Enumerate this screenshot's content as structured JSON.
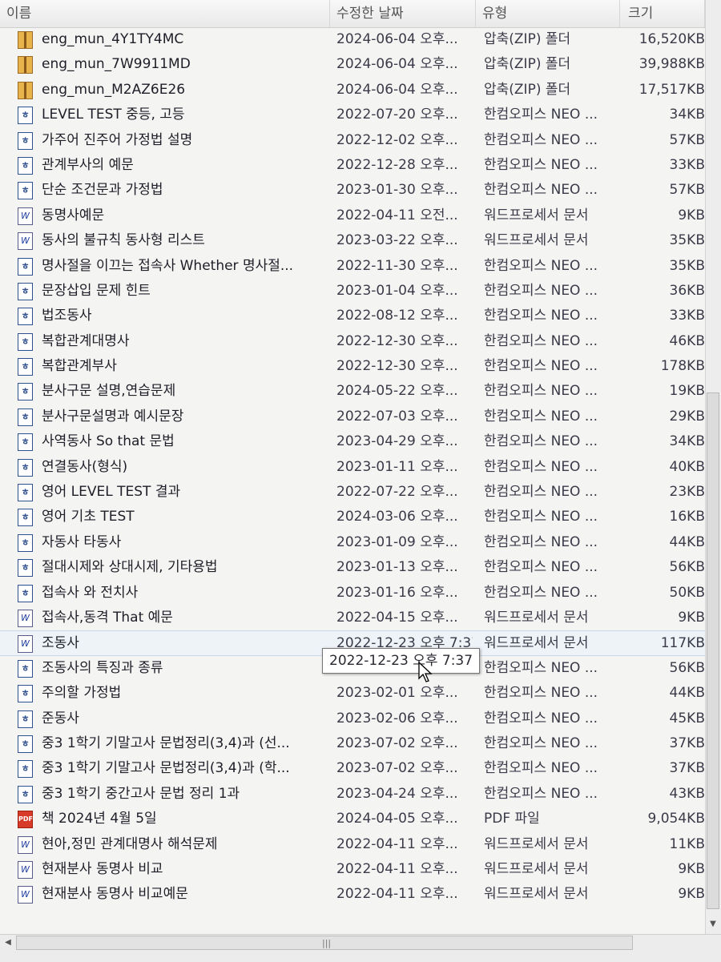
{
  "header": {
    "name": "이름",
    "modified": "수정한 날짜",
    "type": "유형",
    "size": "크기"
  },
  "files": [
    {
      "name": "eng_mun_4Y1TY4MC",
      "date": "2024-06-04 오후...",
      "type": "압축(ZIP) 폴더",
      "size": "16,520KB",
      "icon": "zip-folder-icon"
    },
    {
      "name": "eng_mun_7W9911MD",
      "date": "2024-06-04 오후...",
      "type": "압축(ZIP) 폴더",
      "size": "39,988KB",
      "icon": "zip-folder-icon"
    },
    {
      "name": "eng_mun_M2AZ6E26",
      "date": "2024-06-04 오후...",
      "type": "압축(ZIP) 폴더",
      "size": "17,517KB",
      "icon": "zip-folder-icon"
    },
    {
      "name": "LEVEL TEST 중등, 고등",
      "date": "2022-07-20 오후...",
      "type": "한컴오피스 NEO ...",
      "size": "34KB",
      "icon": "hwp-document-icon"
    },
    {
      "name": "가주어 진주어 가정법 설명",
      "date": "2022-12-02 오후...",
      "type": "한컴오피스 NEO ...",
      "size": "57KB",
      "icon": "hwp-document-icon"
    },
    {
      "name": "관계부사의 예문",
      "date": "2022-12-28 오후...",
      "type": "한컴오피스 NEO ...",
      "size": "33KB",
      "icon": "hwp-document-icon"
    },
    {
      "name": "단순 조건문과 가정법",
      "date": "2023-01-30 오후...",
      "type": "한컴오피스 NEO ...",
      "size": "57KB",
      "icon": "hwp-document-icon"
    },
    {
      "name": "동명사예문",
      "date": "2022-04-11 오전...",
      "type": "워드프로세서 문서",
      "size": "9KB",
      "icon": "word-document-icon"
    },
    {
      "name": "동사의 불규칙 동사형 리스트",
      "date": "2023-03-22 오후...",
      "type": "워드프로세서 문서",
      "size": "35KB",
      "icon": "word-document-icon"
    },
    {
      "name": "명사절을 이끄는 접속사 Whether 명사절...",
      "date": "2022-11-30 오후...",
      "type": "한컴오피스 NEO ...",
      "size": "35KB",
      "icon": "hwp-document-icon"
    },
    {
      "name": "문장삽입 문제 힌트",
      "date": "2023-01-04 오후...",
      "type": "한컴오피스 NEO ...",
      "size": "36KB",
      "icon": "hwp-document-icon"
    },
    {
      "name": "법조동사",
      "date": "2022-08-12 오후...",
      "type": "한컴오피스 NEO ...",
      "size": "33KB",
      "icon": "hwp-document-icon"
    },
    {
      "name": "복합관계대명사",
      "date": "2022-12-30 오후...",
      "type": "한컴오피스 NEO ...",
      "size": "46KB",
      "icon": "hwp-document-icon"
    },
    {
      "name": "복합관계부사",
      "date": "2022-12-30 오후...",
      "type": "한컴오피스 NEO ...",
      "size": "178KB",
      "icon": "hwp-document-icon"
    },
    {
      "name": "분사구문 설명,연습문제",
      "date": "2024-05-22 오후...",
      "type": "한컴오피스 NEO ...",
      "size": "19KB",
      "icon": "hwp-document-icon"
    },
    {
      "name": "분사구문설명과 예시문장",
      "date": "2022-07-03 오후...",
      "type": "한컴오피스 NEO ...",
      "size": "29KB",
      "icon": "hwp-document-icon"
    },
    {
      "name": "사역동사 So that 문법",
      "date": "2023-04-29 오후...",
      "type": "한컴오피스 NEO ...",
      "size": "34KB",
      "icon": "hwp-document-icon"
    },
    {
      "name": "연결동사(형식)",
      "date": "2023-01-11 오후...",
      "type": "한컴오피스 NEO ...",
      "size": "40KB",
      "icon": "hwp-document-icon"
    },
    {
      "name": "영어 LEVEL TEST 결과",
      "date": "2022-07-22 오후...",
      "type": "한컴오피스 NEO ...",
      "size": "23KB",
      "icon": "hwp-document-icon"
    },
    {
      "name": "영어 기초 TEST",
      "date": "2024-03-06 오후...",
      "type": "한컴오피스 NEO ...",
      "size": "16KB",
      "icon": "hwp-document-icon"
    },
    {
      "name": "자동사 타동사",
      "date": "2023-01-09 오후...",
      "type": "한컴오피스 NEO ...",
      "size": "44KB",
      "icon": "hwp-document-icon"
    },
    {
      "name": "절대시제와 상대시제, 기타용법",
      "date": "2023-01-13 오후...",
      "type": "한컴오피스 NEO ...",
      "size": "56KB",
      "icon": "hwp-document-icon"
    },
    {
      "name": "접속사 와 전치사",
      "date": "2023-01-16 오후...",
      "type": "한컴오피스 NEO ...",
      "size": "50KB",
      "icon": "hwp-document-icon"
    },
    {
      "name": "접속사,동격 That 예문",
      "date": "2022-04-15 오후...",
      "type": "워드프로세서 문서",
      "size": "9KB",
      "icon": "word-document-icon"
    },
    {
      "name": "조동사",
      "date": "2022-12-23 오후 7:37",
      "type": "워드프로세서 문서",
      "size": "117KB",
      "icon": "word-document-icon"
    },
    {
      "name": "조동사의 특징과 종류",
      "date": "2023-01-27 오후...",
      "type": "한컴오피스 NEO ...",
      "size": "56KB",
      "icon": "hwp-document-icon"
    },
    {
      "name": "주의할 가정법",
      "date": "2023-02-01 오후...",
      "type": "한컴오피스 NEO ...",
      "size": "44KB",
      "icon": "hwp-document-icon"
    },
    {
      "name": "준동사",
      "date": "2023-02-06 오후...",
      "type": "한컴오피스 NEO ...",
      "size": "45KB",
      "icon": "hwp-document-icon"
    },
    {
      "name": "중3 1학기 기말고사 문법정리(3,4)과 (선...",
      "date": "2023-07-02 오후...",
      "type": "한컴오피스 NEO ...",
      "size": "37KB",
      "icon": "hwp-document-icon"
    },
    {
      "name": "중3 1학기 기말고사 문법정리(3,4)과 (학...",
      "date": "2023-07-02 오후...",
      "type": "한컴오피스 NEO ...",
      "size": "37KB",
      "icon": "hwp-document-icon"
    },
    {
      "name": "중3 1학기 중간고사 문법 정리 1과",
      "date": "2023-04-24 오후...",
      "type": "한컴오피스 NEO ...",
      "size": "43KB",
      "icon": "hwp-document-icon"
    },
    {
      "name": "책 2024년 4월 5일",
      "date": "2024-04-05 오후...",
      "type": "PDF 파일",
      "size": "9,054KB",
      "icon": "pdf-icon"
    },
    {
      "name": "현아,정민 관계대명사 해석문제",
      "date": "2022-04-11 오후...",
      "type": "워드프로세서 문서",
      "size": "11KB",
      "icon": "word-document-icon"
    },
    {
      "name": "현재분사 동명사 비교",
      "date": "2022-04-11 오후...",
      "type": "워드프로세서 문서",
      "size": "9KB",
      "icon": "word-document-icon"
    },
    {
      "name": "현재분사 동명사 비교예문",
      "date": "2022-04-11 오후...",
      "type": "워드프로세서 문서",
      "size": "9KB",
      "icon": "word-document-icon"
    }
  ],
  "tooltip": {
    "text": "2022-12-23 오후 7:37"
  },
  "icon_glyphs": {
    "hwp": "ㅎ",
    "word": "W",
    "pdf": "PDF"
  }
}
